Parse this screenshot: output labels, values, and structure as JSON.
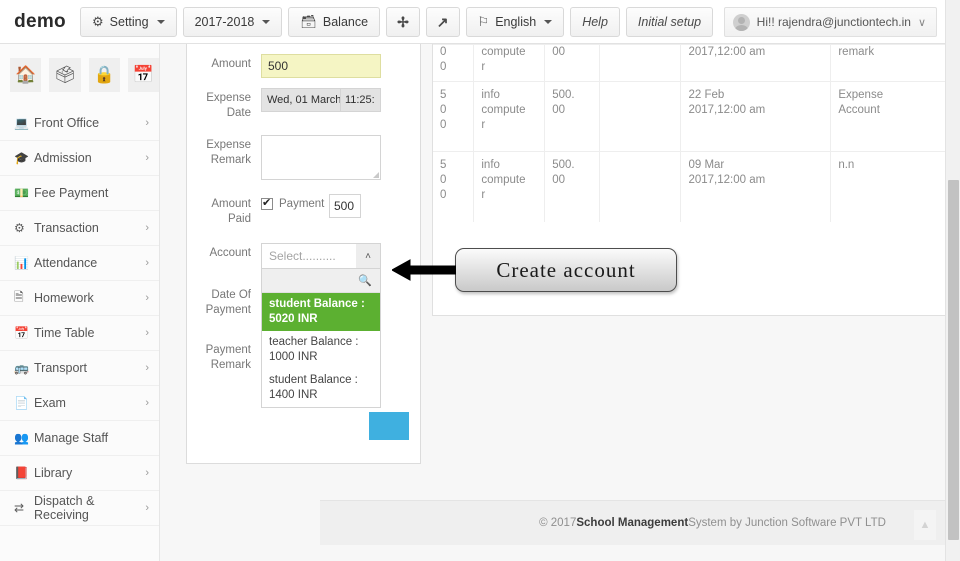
{
  "header": {
    "brand": "demo",
    "buttons": [
      {
        "id": "setting",
        "label": "Setting",
        "icon": "gear-icon",
        "caret": true,
        "italic": false
      },
      {
        "id": "session-year",
        "label": "2017-2018",
        "icon": "",
        "caret": true,
        "italic": false
      },
      {
        "id": "balance",
        "label": "Balance",
        "icon": "database-icon",
        "caret": false,
        "italic": false
      },
      {
        "id": "expand",
        "label": "",
        "icon": "expand-icon",
        "caret": false,
        "italic": false
      },
      {
        "id": "fullscreen",
        "label": "",
        "icon": "resize-icon",
        "caret": false,
        "italic": false
      },
      {
        "id": "language",
        "label": "English",
        "icon": "flag-icon",
        "caret": true,
        "italic": false
      },
      {
        "id": "help",
        "label": "Help",
        "icon": "",
        "caret": false,
        "italic": true
      },
      {
        "id": "initial-setup",
        "label": "Initial setup",
        "icon": "",
        "caret": false,
        "italic": true
      }
    ],
    "user": {
      "label": "Hi!! rajendra@junctiontech.in",
      "chevron": "∨"
    }
  },
  "sidebar": {
    "quick_icons": [
      {
        "id": "home",
        "name": "home-icon",
        "glyph": "⌂"
      },
      {
        "id": "idcard",
        "name": "id-card-icon",
        "glyph": "⌗"
      },
      {
        "id": "lock",
        "name": "lock-icon",
        "glyph": "ὑ2"
      },
      {
        "id": "calendar",
        "name": "calendar-icon",
        "glyph": "Ὄ5"
      }
    ],
    "items": [
      {
        "label": "Front Office",
        "icon": "monitor-icon",
        "arrow": "›"
      },
      {
        "label": "Admission",
        "icon": "graduation-icon",
        "arrow": "›"
      },
      {
        "label": "Fee Payment",
        "icon": "money-icon",
        "arrow": ""
      },
      {
        "label": "Transaction",
        "icon": "gear-icon",
        "arrow": "›"
      },
      {
        "label": "Attendance",
        "icon": "chart-icon",
        "arrow": "›"
      },
      {
        "label": "Homework",
        "icon": "doc-icon",
        "arrow": "›"
      },
      {
        "label": "Time Table",
        "icon": "calendar-icon",
        "arrow": "›"
      },
      {
        "label": "Transport",
        "icon": "bus-icon",
        "arrow": "›"
      },
      {
        "label": "Exam",
        "icon": "file-icon",
        "arrow": "›"
      },
      {
        "label": "Manage Staff",
        "icon": "users-icon",
        "arrow": ""
      },
      {
        "label": "Library",
        "icon": "book-icon",
        "arrow": "›"
      },
      {
        "label": "Dispatch & Receiving",
        "icon": "transfer-icon",
        "arrow": "›"
      }
    ]
  },
  "form": {
    "amount": {
      "label": "Amount",
      "value": "500"
    },
    "expense_date": {
      "label": "Expense Date",
      "date": "Wed, 01 March",
      "time": "11:25:"
    },
    "expense_remark": {
      "label": "Expense Remark",
      "value": ""
    },
    "amount_paid": {
      "label": "Amount Paid",
      "checked": true,
      "sub_label": "Payment",
      "payment_value": "500"
    },
    "account": {
      "label": "Account",
      "placeholder": "Select..........",
      "arrow": "˄",
      "search_icon": "search-icon",
      "options": [
        {
          "text": "student Balance : 5020 INR",
          "selected": true
        },
        {
          "text": "teacher Balance : 1000 INR",
          "selected": false
        },
        {
          "text": "student Balance : 1400 INR",
          "selected": false
        }
      ]
    },
    "date_of_payment": {
      "label": "Date Of Payment"
    },
    "payment_remark": {
      "label": "Payment Remark"
    }
  },
  "table": {
    "columns": [
      "amount",
      "name",
      "paid",
      "blank",
      "date",
      "remark",
      "pay",
      "delete",
      "receipt"
    ],
    "rows": [
      {
        "clipped": true,
        "amount": "0\n0",
        "name": "compute\nr",
        "paid": "00",
        "blank": "",
        "date": "2017,12:00 am",
        "remark": "remark",
        "pay": "",
        "delete": "",
        "receipt": ""
      },
      {
        "clipped": false,
        "amount": "5\n0\n0",
        "name": "info\ncompute\nr",
        "paid": "500.\n00",
        "blank": "",
        "date": "22 Feb\n2017,12:00 am",
        "remark": "Expense\nAccount",
        "pay": "$",
        "delete": "✖",
        "receipt": "὜E"
      },
      {
        "clipped": false,
        "amount": "5\n0\n0",
        "name": "info\ncompute\nr",
        "paid": "500.\n00",
        "blank": "",
        "date": "09 Mar\n2017,12:00 am",
        "remark": "n.n",
        "pay": "$",
        "delete": "✖",
        "receipt": "὜E"
      }
    ]
  },
  "callout": {
    "text": "Create  account"
  },
  "footer": {
    "copyright": "© 2017 ",
    "bold": "School Management",
    "rest": " System by Junction Software PVT LTD",
    "to_top_icon": "chevron-up-icon",
    "to_top_glyph": "▲"
  },
  "colors": {
    "accent_green": "#5cb031",
    "accent_blue": "#3fb0e0",
    "amount_highlight": "#f5f5c4"
  }
}
